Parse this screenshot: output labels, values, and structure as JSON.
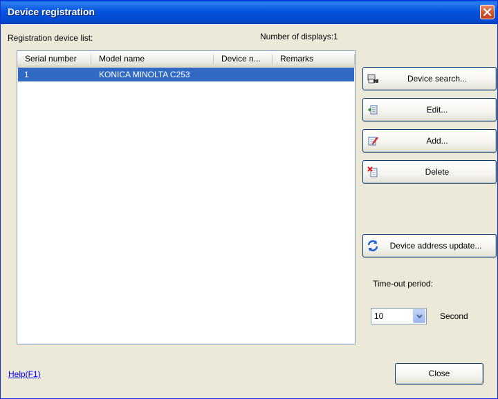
{
  "window": {
    "title": "Device registration"
  },
  "list_label": "Registration device list:",
  "count_text": "Number of displays:1",
  "table": {
    "columns": [
      "Serial number",
      "Model name",
      "Device n...",
      "Remarks"
    ],
    "rows": [
      {
        "serial": "1",
        "model": "KONICA MINOLTA C253",
        "device_name": "",
        "remarks": ""
      }
    ]
  },
  "buttons": {
    "device_search": "Device search...",
    "edit": "Edit...",
    "add": "Add...",
    "delete": "Delete",
    "address_update": "Device address update...",
    "close": "Close"
  },
  "timeout": {
    "label": "Time-out period:",
    "value": "10",
    "unit": "Second"
  },
  "help_link": "Help(F1)",
  "colors": {
    "title_bar": "#0653dd",
    "selection": "#316ac5",
    "dialog_bg": "#ece9d8"
  },
  "icons": [
    "close-icon",
    "device-search-icon",
    "edit-icon",
    "add-icon",
    "delete-icon",
    "refresh-icon",
    "chevron-down-icon"
  ]
}
